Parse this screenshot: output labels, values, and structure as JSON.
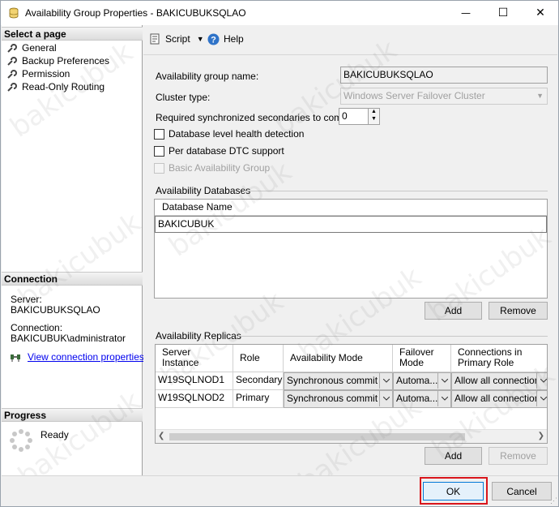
{
  "window": {
    "title": "Availability Group Properties - BAKICUBUKSQLAO",
    "minimize_glyph": "—",
    "maximize_glyph": "☐",
    "close_glyph": "✕"
  },
  "left_pane": {
    "select_page_header": "Select a page",
    "pages": [
      {
        "label": "General",
        "icon": "wrench-icon"
      },
      {
        "label": "Backup Preferences",
        "icon": "wrench-icon"
      },
      {
        "label": "Permission",
        "icon": "wrench-icon"
      },
      {
        "label": "Read-Only Routing",
        "icon": "wrench-icon"
      }
    ],
    "connection_header": "Connection",
    "server_label": "Server:",
    "server_value": "BAKICUBUKSQLAO",
    "connection_label": "Connection:",
    "connection_value": "BAKICUBUK\\administrator",
    "view_connection_link": "View connection properties",
    "progress_header": "Progress",
    "progress_status": "Ready"
  },
  "toolbar": {
    "script_label": "Script",
    "help_label": "Help"
  },
  "general": {
    "ag_name_label": "Availability group name:",
    "ag_name_value": "BAKICUBUKSQLAO",
    "cluster_type_label": "Cluster type:",
    "cluster_type_value": "Windows Server Failover Cluster",
    "required_sync_label": "Required synchronized secondaries to commit:",
    "required_sync_value": "0",
    "db_health_label": "Database level health detection",
    "dtc_label": "Per database DTC support",
    "basic_ag_label": "Basic Availability Group"
  },
  "availability_databases": {
    "group_label": "Availability Databases",
    "column_header": "Database Name",
    "rows": [
      "BAKICUBUK"
    ],
    "add_label": "Add",
    "remove_label": "Remove"
  },
  "availability_replicas": {
    "group_label": "Availability Replicas",
    "columns": [
      "Server Instance",
      "Role",
      "Availability Mode",
      "Failover Mode",
      "Connections in Primary Role"
    ],
    "rows": [
      {
        "server": "W19SQLNOD1",
        "role": "Secondary",
        "mode": "Synchronous commit",
        "failover": "Automa...",
        "connections": "Allow all connections"
      },
      {
        "server": "W19SQLNOD2",
        "role": "Primary",
        "mode": "Synchronous commit",
        "failover": "Automa...",
        "connections": "Allow all connections"
      }
    ],
    "add_label": "Add",
    "remove_label": "Remove"
  },
  "footer": {
    "ok_label": "OK",
    "cancel_label": "Cancel"
  },
  "watermark_text": "bakicubuk",
  "colors": {
    "ok_highlight": "#d9161c",
    "link": "#0000ee"
  }
}
